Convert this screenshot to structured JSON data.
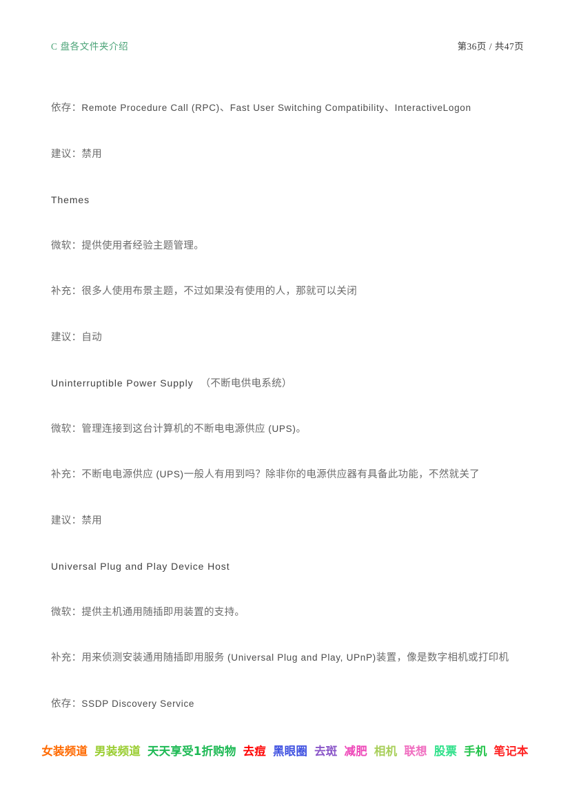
{
  "header": {
    "title": "C 盘各文件夹介绍",
    "page_label_prefix": "第",
    "page_current": "36页",
    "separator": "/",
    "page_total_prefix": "共",
    "page_total": "47页",
    "title_color": "#4ba377"
  },
  "body": {
    "paragraphs": [
      {
        "id": "depends-rpc",
        "kind": "cn",
        "label": "依存：",
        "value": "Remote Procedure Call (RPC)、Fast User Switching Compatibility、InteractiveLogon"
      },
      {
        "id": "advice-disable-1",
        "kind": "cn",
        "label": "建议：",
        "value": "禁用"
      },
      {
        "id": "service-themes",
        "kind": "en",
        "label": "",
        "value": "Themes"
      },
      {
        "id": "microsoft-themes",
        "kind": "cn",
        "label": "微软：",
        "value": "提供使用者经验主题管理。"
      },
      {
        "id": "supplement-themes",
        "kind": "cn",
        "label": "补充：",
        "value": "很多人使用布景主题，不过如果没有使用的人，那就可以关闭"
      },
      {
        "id": "advice-auto",
        "kind": "cn",
        "label": "建议：",
        "value": "自动"
      },
      {
        "id": "service-ups",
        "kind": "en",
        "label": "",
        "value": "Uninterruptible Power Supply",
        "value_cn": "（不断电供电系统）"
      },
      {
        "id": "microsoft-ups",
        "kind": "cn",
        "label": "微软：",
        "value": "管理连接到这台计算机的不断电电源供应 (UPS)。"
      },
      {
        "id": "supplement-ups",
        "kind": "cn",
        "label": "补充：",
        "value": "不断电电源供应 (UPS)一般人有用到吗？除非你的电源供应器有具备此功能，不然就关了"
      },
      {
        "id": "advice-disable-2",
        "kind": "cn",
        "label": "建议：",
        "value": "禁用"
      },
      {
        "id": "service-upnp",
        "kind": "en",
        "label": "",
        "value": "Universal Plug and Play Device Host"
      },
      {
        "id": "microsoft-upnp",
        "kind": "cn",
        "label": "微软：",
        "value": "提供主机通用随插即用装置的支持。"
      },
      {
        "id": "supplement-upnp",
        "kind": "cn",
        "label": "补充：",
        "value": "用来侦测安装通用随插即用服务 (Universal Plug and Play, UPnP)装置，像是数字相机或打印机"
      },
      {
        "id": "depends-ssdp",
        "kind": "cn",
        "label": "依存：",
        "value": "SSDP Discovery Service"
      }
    ]
  },
  "footer": {
    "links": [
      {
        "label": "女装频道",
        "color": "#ff6a00"
      },
      {
        "label": "男装频道",
        "color": "#9acd32"
      },
      {
        "label": "天天享受1折购物",
        "color": "#1db954"
      },
      {
        "label": "去痘",
        "color": "#ff0000"
      },
      {
        "label": "黑眼圈",
        "color": "#3d4fe0"
      },
      {
        "label": "去斑",
        "color": "#8a56c8"
      },
      {
        "label": "减肥",
        "color": "#ee47b8"
      },
      {
        "label": "相机",
        "color": "#a8cf5a"
      },
      {
        "label": "联想",
        "color": "#f06ec0"
      },
      {
        "label": "股票",
        "color": "#2fe08a"
      },
      {
        "label": "手机",
        "color": "#22c34a"
      },
      {
        "label": "笔记本",
        "color": "#ff2222"
      }
    ]
  }
}
